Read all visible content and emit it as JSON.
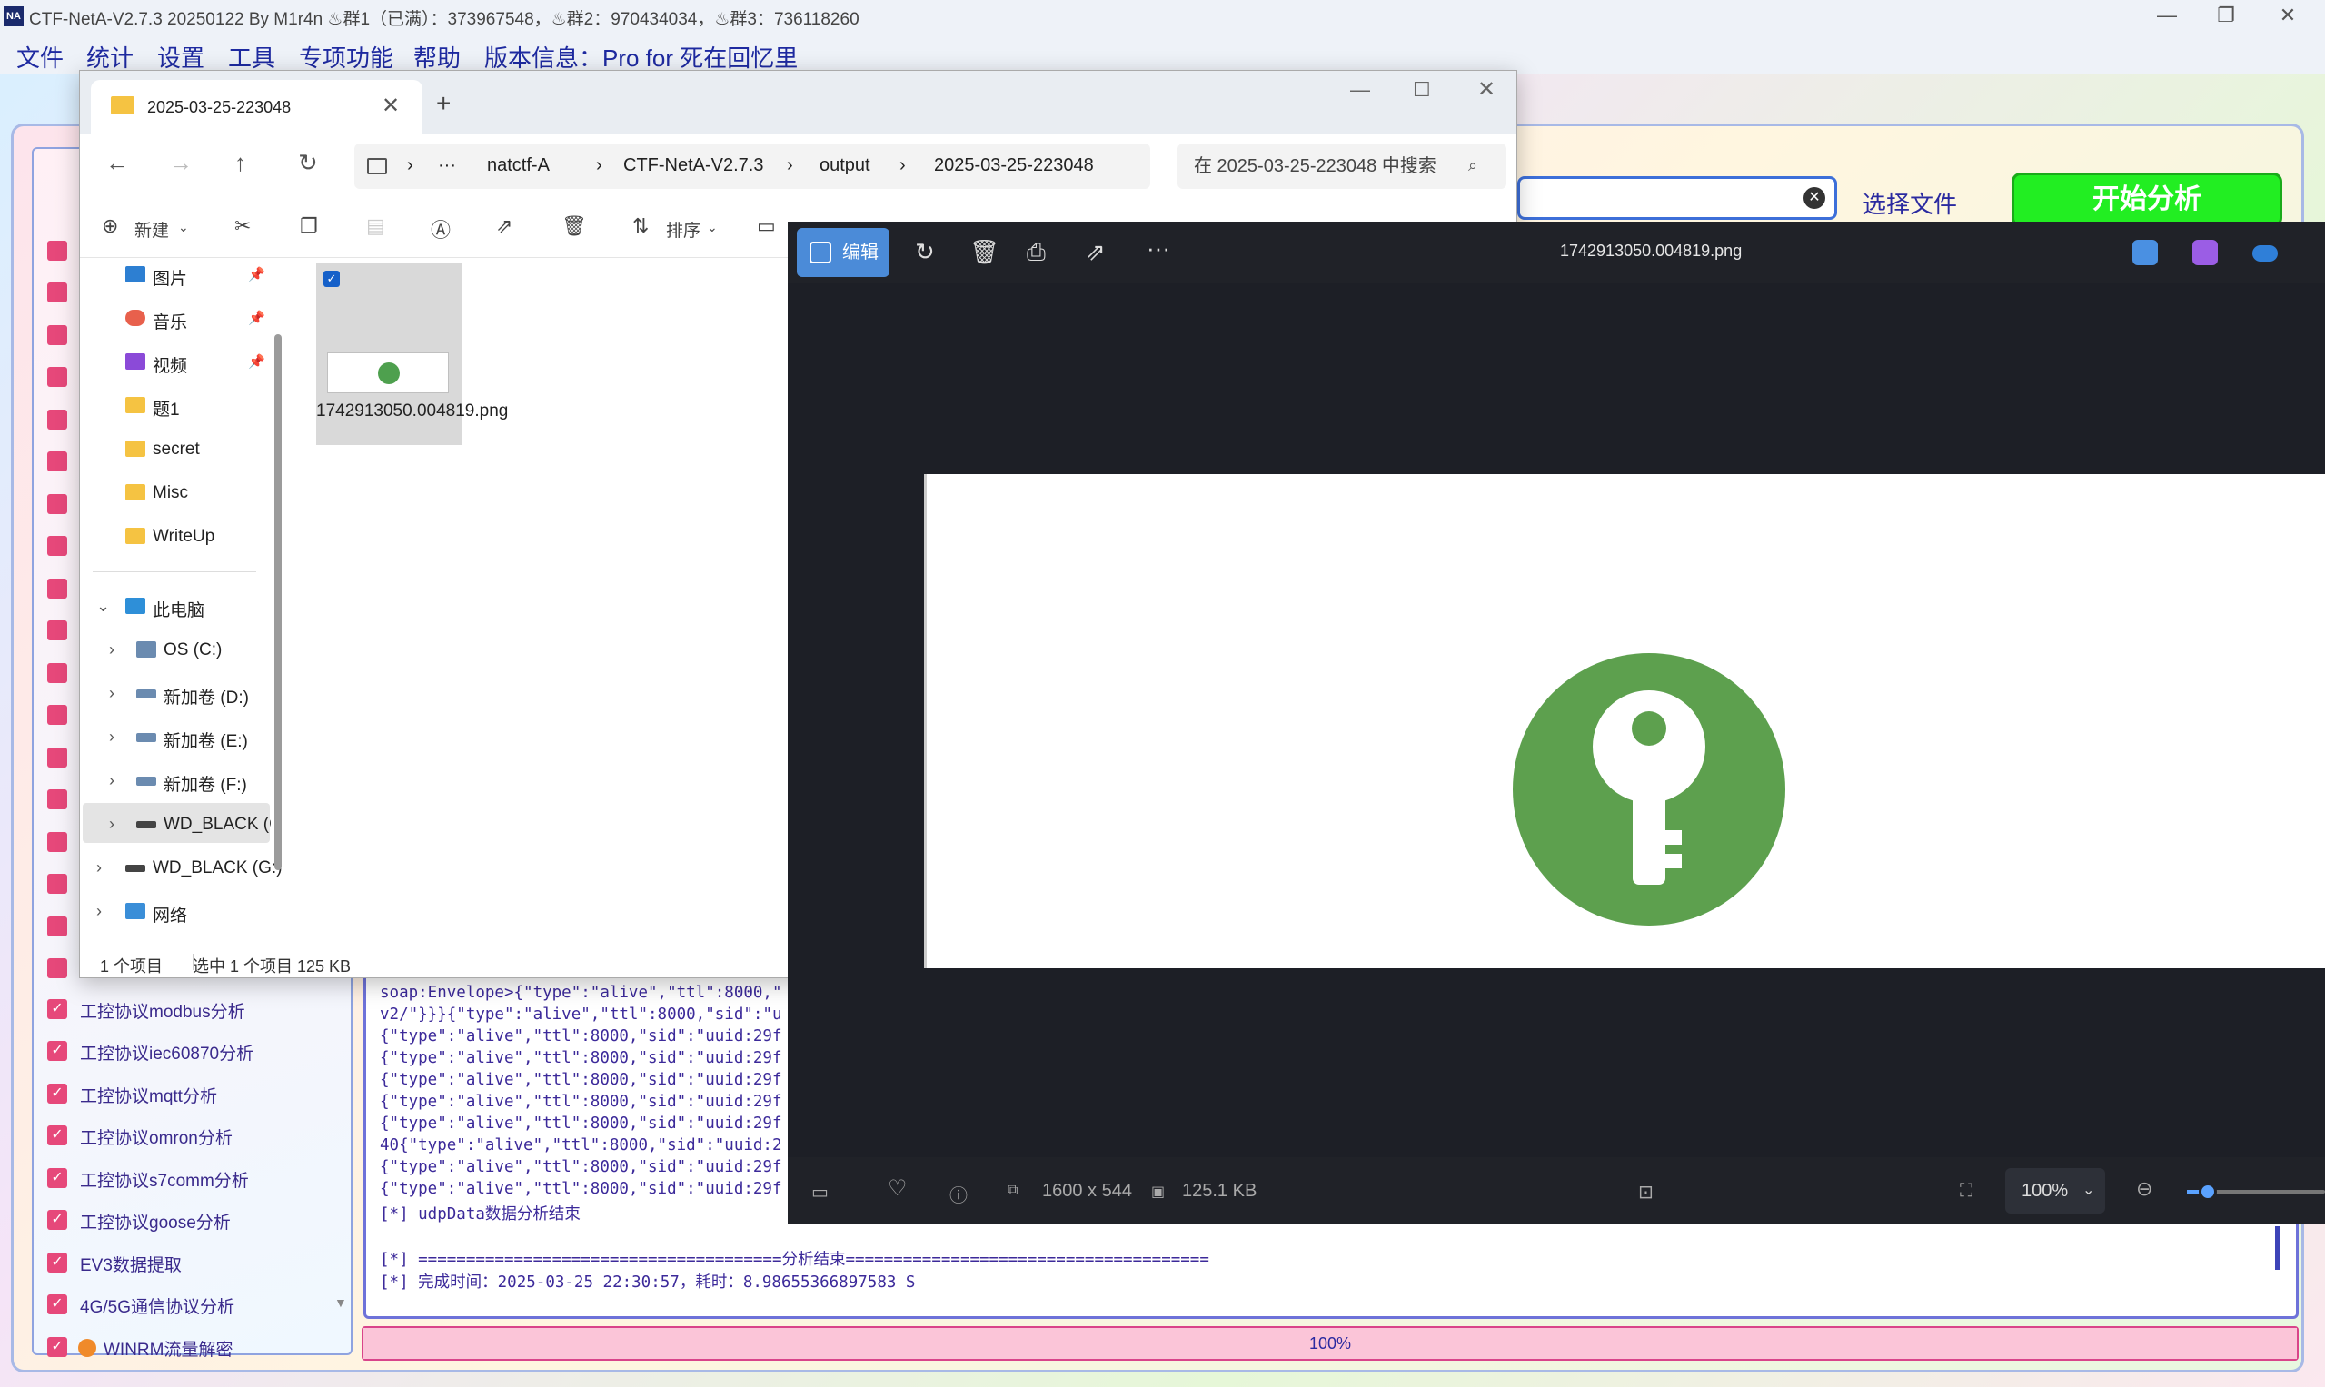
{
  "base_window": {
    "title": "CTF-NetA-V2.7.3 20250122 By M1r4n  ♨群1（已满）：373967548，♨群2：970434034，♨群3：736118260",
    "logo_text": "NA",
    "minimize": "—",
    "restore": "❐",
    "close": "✕",
    "menu": [
      "文件",
      "统计",
      "设置",
      "工具",
      "专项功能",
      "帮助",
      "版本信息：Pro for 死在回忆里"
    ],
    "left_list_items": [
      "工控协议modbus分析",
      "工控协议iec60870分析",
      "工控协议mqtt分析",
      "工控协议omron分析",
      "工控协议s7comm分析",
      "工控协议goose分析",
      "EV3数据提取",
      "4G/5G通信协议分析",
      "WINRM流量解密"
    ],
    "checkmark": "✓",
    "choose_file_label": "选择文件",
    "start_button_label": "开始分析",
    "log_lines": [
      "soap:Envelope>{\"type\":\"alive\",\"ttl\":8000,\"",
      "v2/\"}}}{\"type\":\"alive\",\"ttl\":8000,\"sid\":\"u",
      "{\"type\":\"alive\",\"ttl\":8000,\"sid\":\"uuid:29f",
      "{\"type\":\"alive\",\"ttl\":8000,\"sid\":\"uuid:29f",
      "{\"type\":\"alive\",\"ttl\":8000,\"sid\":\"uuid:29f",
      "{\"type\":\"alive\",\"ttl\":8000,\"sid\":\"uuid:29f",
      "{\"type\":\"alive\",\"ttl\":8000,\"sid\":\"uuid:29f",
      "40{\"type\":\"alive\",\"ttl\":8000,\"sid\":\"uuid:2",
      "{\"type\":\"alive\",\"ttl\":8000,\"sid\":\"uuid:29f",
      "{\"type\":\"alive\",\"ttl\":8000,\"sid\":\"uuid:29f",
      "[*] udpData数据分析结束",
      "",
      "[*] ======================================分析结束======================================",
      "[*] 完成时间：2025-03-25 22:30:57，耗时：8.98655366897583 S"
    ],
    "progress_value": 100,
    "progress_label": "100%"
  },
  "explorer": {
    "tab_title": "2025-03-25-223048",
    "tab_close": "✕",
    "new_tab": "+",
    "nav": {
      "back": "←",
      "forward": "→",
      "up": "↑",
      "refresh": "↻"
    },
    "breadcrumb": [
      "natctf-A",
      "CTF-NetA-V2.7.3",
      "output",
      "2025-03-25-223048"
    ],
    "breadcrumb_more": "···",
    "search_placeholder": "在 2025-03-25-223048 中搜索",
    "toolbar": {
      "new_label": "新建",
      "sort_label": "排序"
    },
    "sidebar": [
      {
        "label": "图片",
        "pinned": true
      },
      {
        "label": "音乐",
        "pinned": true
      },
      {
        "label": "视频",
        "pinned": true
      },
      {
        "label": "题1"
      },
      {
        "label": "secret"
      },
      {
        "label": "Misc"
      },
      {
        "label": "WriteUp"
      },
      {
        "label": "此电脑"
      },
      {
        "label": "OS (C:)"
      },
      {
        "label": "新加卷 (D:)"
      },
      {
        "label": "新加卷 (E:)"
      },
      {
        "label": "新加卷 (F:)"
      },
      {
        "label": "WD_BLACK (G"
      },
      {
        "label": "WD_BLACK (G:)"
      },
      {
        "label": "网络"
      }
    ],
    "file": {
      "name": "1742913050.004819.png"
    },
    "status": {
      "count": "1 个项目",
      "selected": "选中 1 个项目  125 KB"
    }
  },
  "photos": {
    "edit_label": "编辑",
    "file_title": "1742913050.004819.png",
    "dimensions": "1600 x 544",
    "file_size": "125.1 KB",
    "zoom": "100%",
    "zoom_fraction": 0.15,
    "key_color": "#5da04e"
  }
}
